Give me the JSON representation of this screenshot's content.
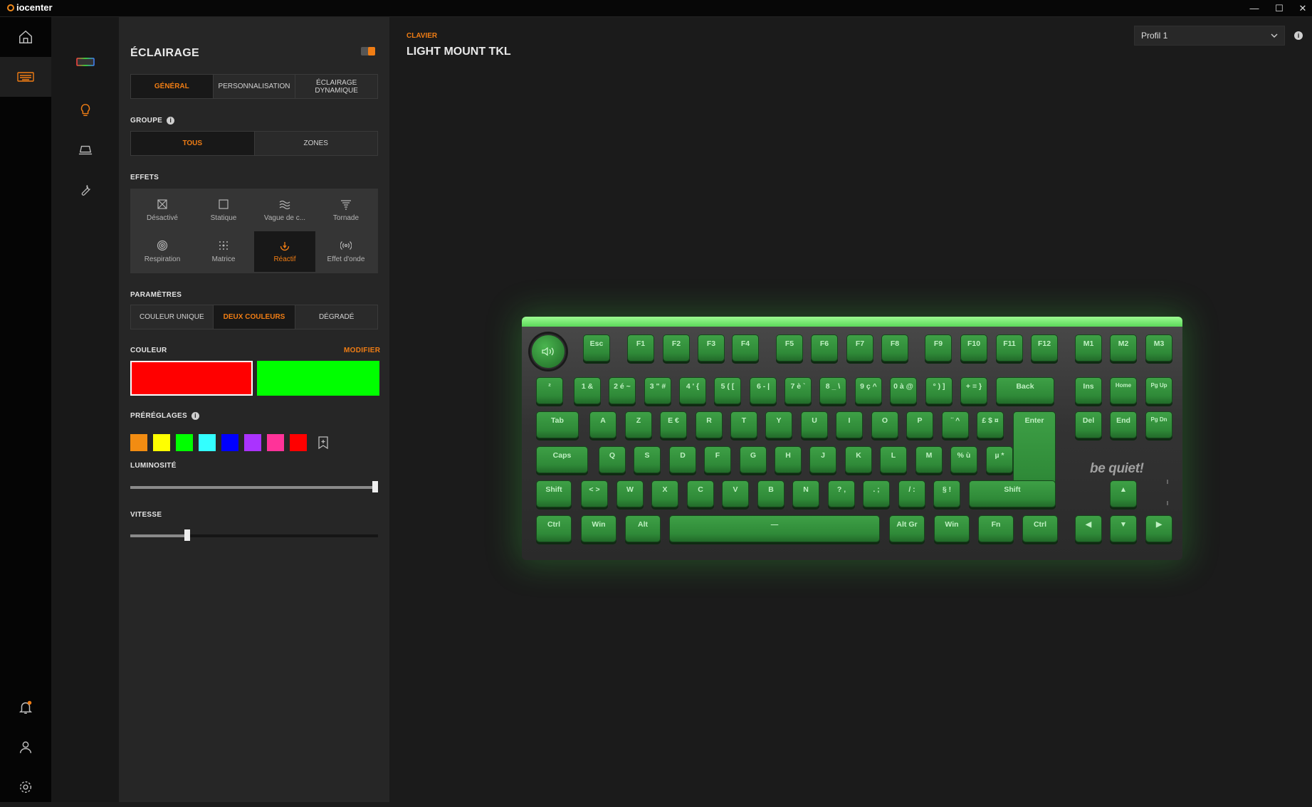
{
  "app": {
    "name": "iocenter"
  },
  "window": {
    "minimize": "—",
    "maximize": "☐",
    "close": "✕"
  },
  "panel": {
    "title": "ÉCLAIRAGE",
    "tabs": [
      {
        "label": "GÉNÉRAL",
        "selected": true
      },
      {
        "label": "PERSONNALISATION",
        "selected": false
      },
      {
        "label": "ÉCLAIRAGE DYNAMIQUE",
        "selected": false
      }
    ],
    "group_label": "GROUPE",
    "group_options": [
      {
        "label": "TOUS",
        "selected": true
      },
      {
        "label": "ZONES",
        "selected": false
      }
    ],
    "effects_label": "EFFETS",
    "effects": [
      {
        "label": "Désactivé",
        "icon": "disabled-icon",
        "selected": false
      },
      {
        "label": "Statique",
        "icon": "square-icon",
        "selected": false
      },
      {
        "label": "Vague de c...",
        "icon": "wave-icon",
        "selected": false
      },
      {
        "label": "Tornade",
        "icon": "tornado-icon",
        "selected": false
      },
      {
        "label": "Respiration",
        "icon": "breathing-icon",
        "selected": false
      },
      {
        "label": "Matrice",
        "icon": "matrix-icon",
        "selected": false
      },
      {
        "label": "Réactif",
        "icon": "reactive-icon",
        "selected": true
      },
      {
        "label": "Effet d'onde",
        "icon": "ripple-icon",
        "selected": false
      }
    ],
    "params_label": "PARAMÈTRES",
    "params": [
      {
        "label": "COULEUR UNIQUE",
        "selected": false
      },
      {
        "label": "DEUX COULEURS",
        "selected": true
      },
      {
        "label": "DÉGRADÉ",
        "selected": false
      }
    ],
    "color_label": "COULEUR",
    "modify_label": "MODIFIER",
    "colors": [
      "#ff0000",
      "#00ff00"
    ],
    "presets_label": "PRÉRÉGLAGES",
    "presets": [
      "#f28c12",
      "#ffff00",
      "#00ff00",
      "#33ffff",
      "#0000ff",
      "#aa33ff",
      "#ff3399",
      "#ff0000"
    ],
    "brightness_label": "LUMINOSITÉ",
    "brightness": 1.0,
    "speed_label": "VITESSE",
    "speed": 0.23
  },
  "device": {
    "category": "CLAVIER",
    "name": "LIGHT MOUNT TKL",
    "profile": "Profil 1",
    "brand": "be quiet!"
  },
  "keyboard": {
    "rows": [
      [
        "Esc",
        "F1",
        "F2",
        "F3",
        "F4",
        "F5",
        "F6",
        "F7",
        "F8",
        "F9",
        "F10",
        "F11",
        "F12",
        "M1",
        "M2",
        "M3"
      ],
      [
        "²",
        "1 &",
        "2 é ~",
        "3 \" #",
        "4 ' {",
        "5 ( [",
        "6 - |",
        "7 è `",
        "8 _ \\",
        "9 ç ^",
        "0 à @",
        "° ) ]",
        "+ = }",
        "Back",
        "Ins",
        "Home",
        "Pg Up"
      ],
      [
        "Tab",
        "A",
        "Z",
        "E €",
        "R",
        "T",
        "Y",
        "U",
        "I",
        "O",
        "P",
        "¨ ^",
        "£ $ ¤",
        "Enter",
        "Del",
        "End",
        "Pg Dn"
      ],
      [
        "Caps",
        "Q",
        "S",
        "D",
        "F",
        "G",
        "H",
        "J",
        "K",
        "L",
        "M",
        "% ù",
        "µ *"
      ],
      [
        "Shift",
        "< >",
        "W",
        "X",
        "C",
        "V",
        "B",
        "N",
        "? ,",
        ". ;",
        "/ :",
        "§ !",
        "Shift",
        "▲"
      ],
      [
        "Ctrl",
        "Win",
        "Alt",
        "—",
        "Alt Gr",
        "Win",
        "Fn",
        "Ctrl",
        "◀",
        "▼",
        "▶"
      ]
    ]
  },
  "colors": {
    "accent": "#f07d14",
    "key_green": "#2f8a38",
    "glow": "#7ff07a"
  }
}
